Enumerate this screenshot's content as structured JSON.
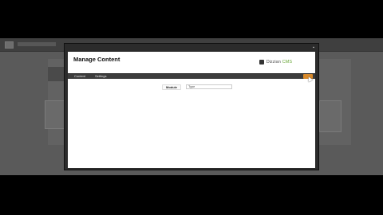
{
  "modal": {
    "title": "Manage Content",
    "brand": {
      "name": "Dizzian",
      "suffix": "CMS"
    },
    "tabs": [
      {
        "label": "Content"
      },
      {
        "label": "Settings"
      }
    ],
    "form": {
      "module_label": "Module",
      "module_value": "Type"
    }
  },
  "icons": [
    "app-logo-icon",
    "close-icon",
    "brand-icon",
    "mouse-cursor-icon"
  ],
  "colors": {
    "overlay": "#000000",
    "tab_bar": "#3c3c3c",
    "accent": "#d98a2b",
    "brand_suffix": "#6aa83a"
  }
}
